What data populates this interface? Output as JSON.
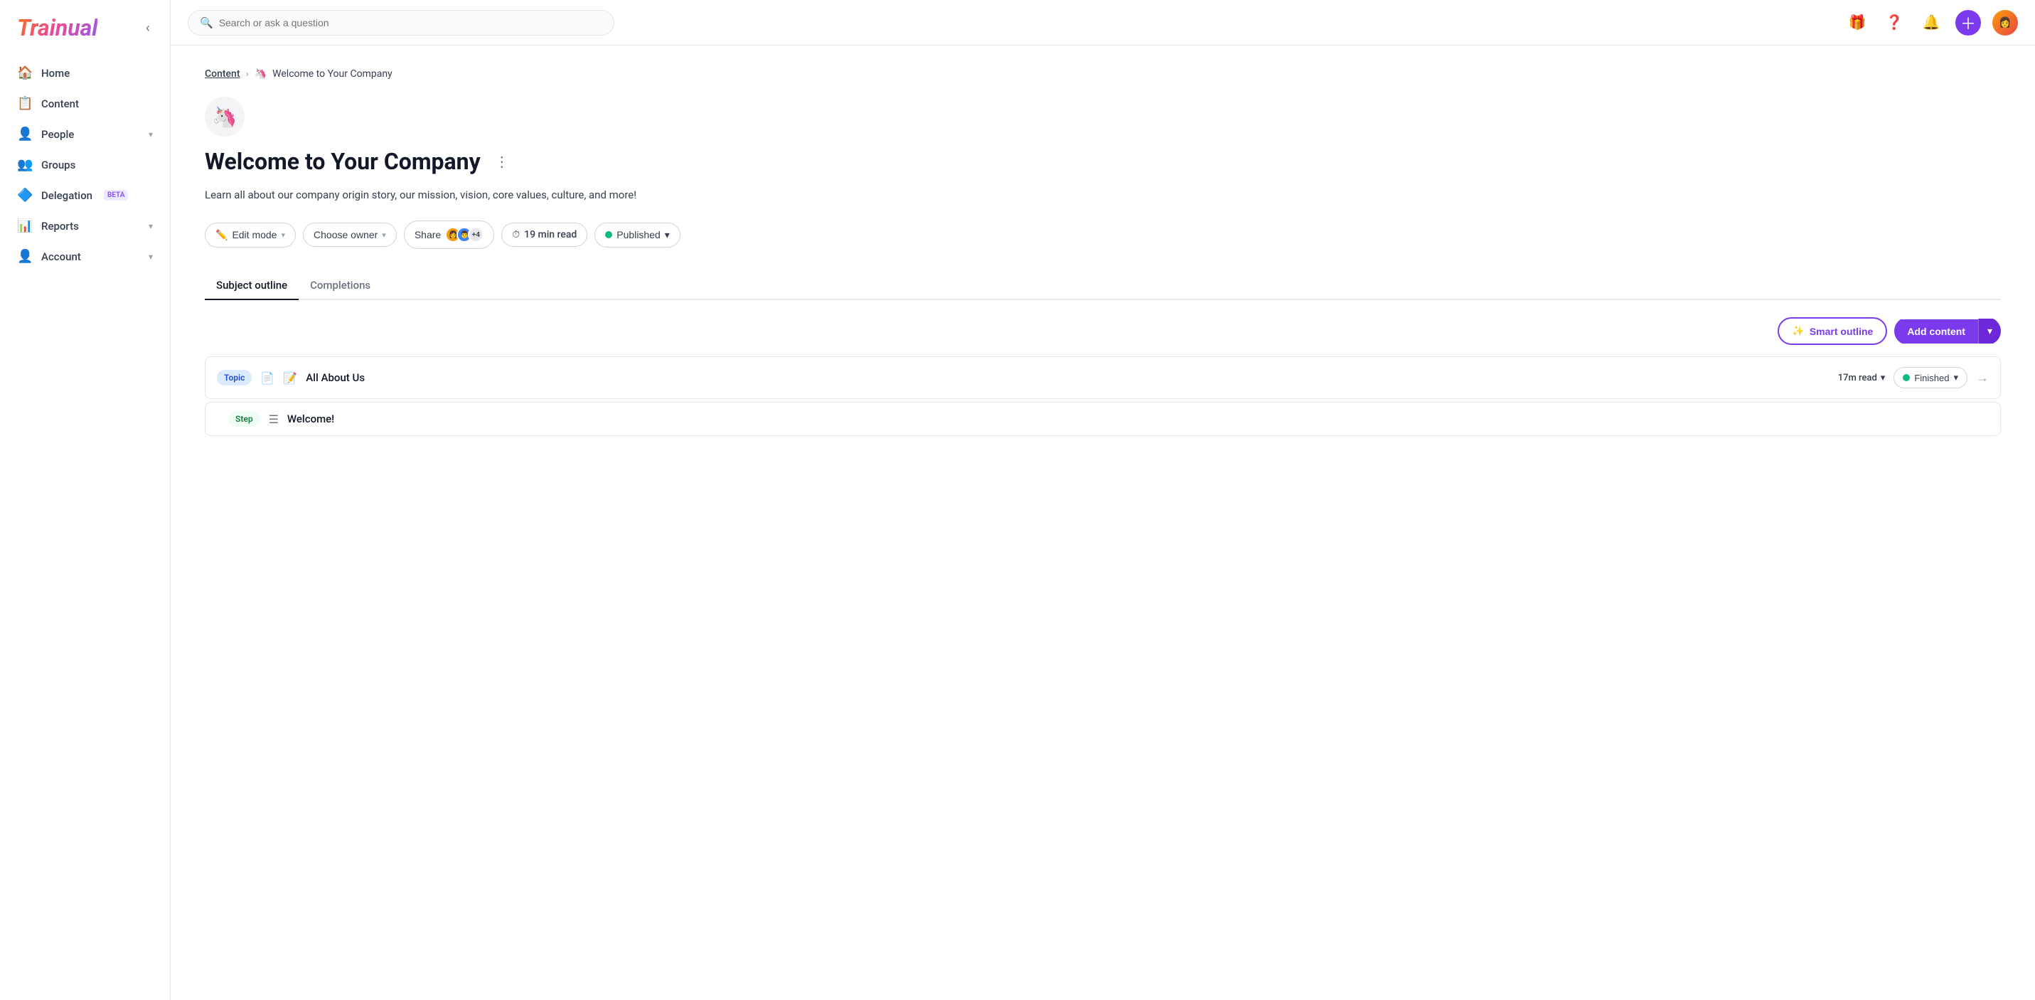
{
  "app": {
    "name": "Trainual"
  },
  "topbar": {
    "search_placeholder": "Search or ask a question"
  },
  "sidebar": {
    "nav_items": [
      {
        "id": "home",
        "label": "Home",
        "icon": "🏠",
        "has_chevron": false,
        "badge": null
      },
      {
        "id": "content",
        "label": "Content",
        "icon": "📋",
        "has_chevron": false,
        "badge": null
      },
      {
        "id": "people",
        "label": "People",
        "icon": "👤",
        "has_chevron": true,
        "badge": null
      },
      {
        "id": "groups",
        "label": "Groups",
        "icon": "👥",
        "has_chevron": false,
        "badge": null
      },
      {
        "id": "delegation",
        "label": "Delegation",
        "icon": "🔷",
        "has_chevron": false,
        "badge": "BETA"
      },
      {
        "id": "reports",
        "label": "Reports",
        "icon": "📊",
        "has_chevron": true,
        "badge": null
      },
      {
        "id": "account",
        "label": "Account",
        "icon": "👤",
        "has_chevron": true,
        "badge": null
      }
    ]
  },
  "breadcrumb": {
    "parent": "Content",
    "current": "Welcome to Your Company",
    "emoji": "🦄"
  },
  "subject": {
    "emoji": "🦄",
    "title": "Welcome to Your Company",
    "description": "Learn all about our company origin story, our mission, vision, core values, culture, and more!"
  },
  "action_bar": {
    "edit_mode_label": "Edit mode",
    "choose_owner_label": "Choose owner",
    "share_label": "Share",
    "share_count": "+4",
    "read_time": "19 min read",
    "published_label": "Published"
  },
  "tabs": [
    {
      "id": "subject-outline",
      "label": "Subject outline",
      "active": true
    },
    {
      "id": "completions",
      "label": "Completions",
      "active": false
    }
  ],
  "toolbar": {
    "smart_outline_label": "Smart outline",
    "add_content_label": "Add content"
  },
  "content_list": {
    "topic": {
      "badge": "Topic",
      "icon": "📄",
      "emoji": "📝",
      "name": "All About Us",
      "read_time": "17m read",
      "status": "Finished"
    },
    "step": {
      "badge": "Step",
      "icon": "☰",
      "name": "Welcome!"
    }
  },
  "colors": {
    "purple": "#7c3aed",
    "green": "#10b981",
    "blue": "#1d4ed8"
  }
}
